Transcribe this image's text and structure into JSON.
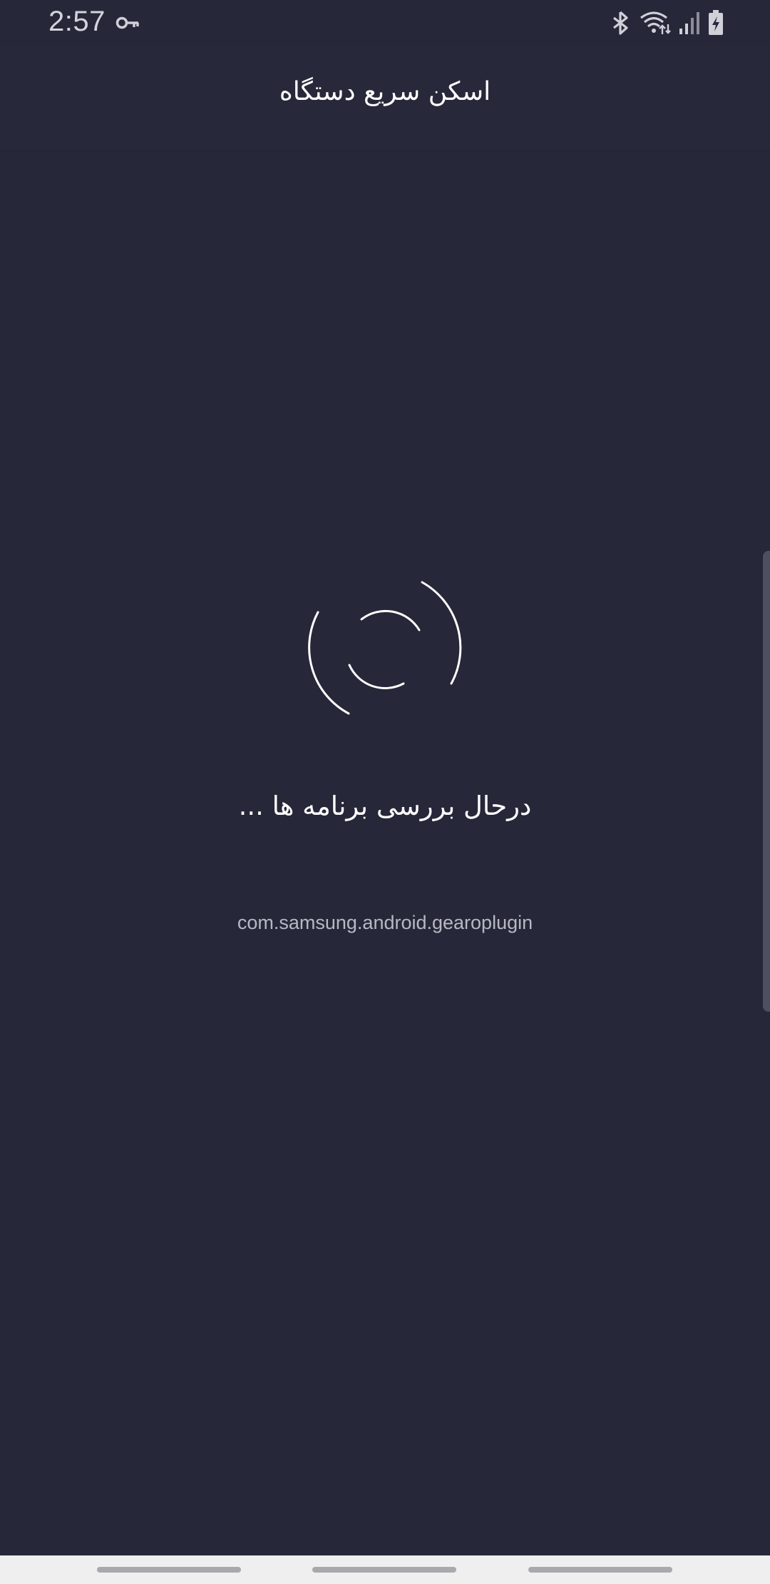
{
  "status_bar": {
    "time": "2:57",
    "icons": [
      "vpn-key-icon",
      "bluetooth-icon",
      "wifi-icon",
      "signal-icon",
      "battery-charging-icon"
    ]
  },
  "header": {
    "title": "اسکن سریع دستگاه"
  },
  "scan": {
    "status_text": "درحال بررسی برنامه ها ...",
    "current_package": "com.samsung.android.gearoplugin"
  },
  "nav": {
    "items": [
      "recent-apps",
      "home",
      "back"
    ]
  },
  "colors": {
    "background": "#262739",
    "header": "#272839",
    "text": "#ffffff",
    "subtext": "#b7b8c4",
    "nav_bar": "#efefef"
  }
}
